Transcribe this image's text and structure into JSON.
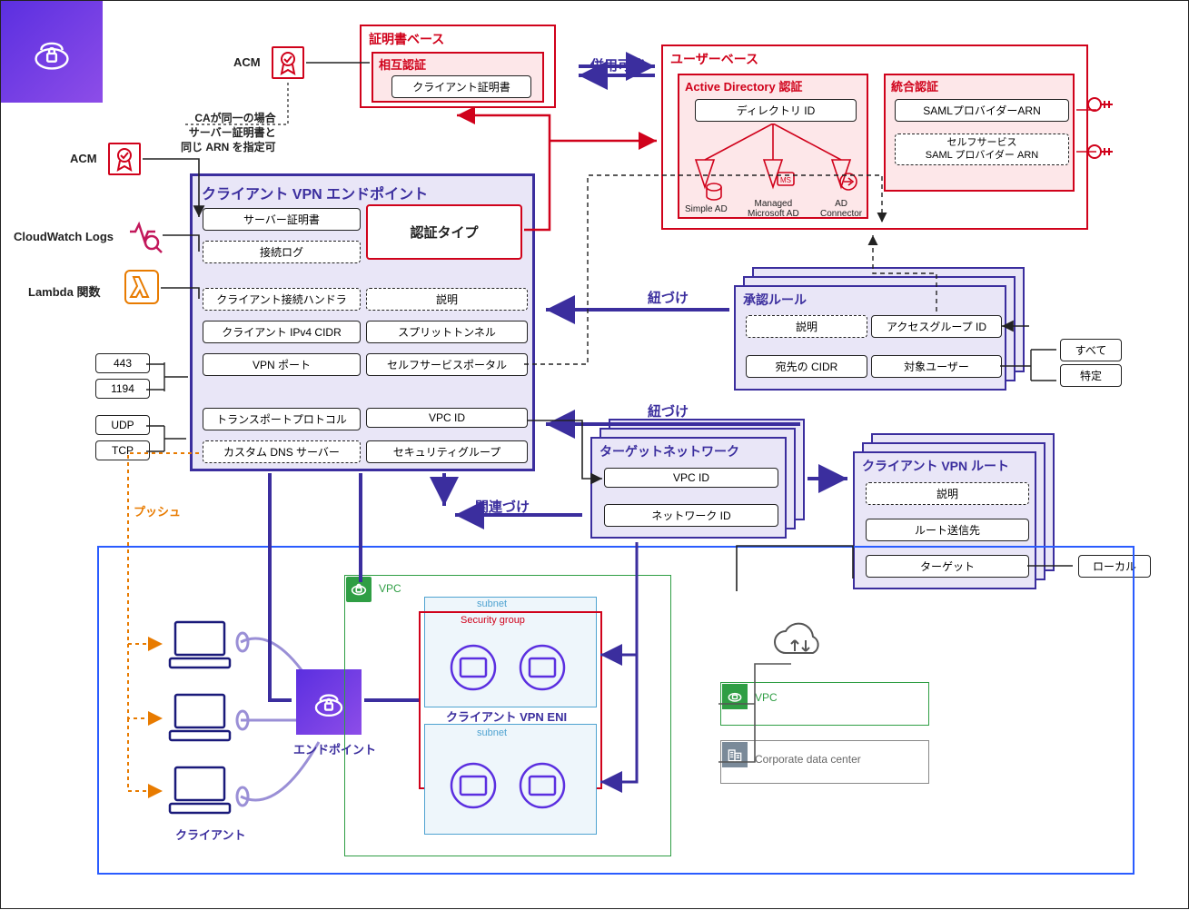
{
  "icon_labels": {
    "acm1": "ACM",
    "acm2": "ACM",
    "cwl": "CloudWatch Logs",
    "lambda": "Lambda 関数"
  },
  "ca_note": "CAが同一の場合\nサーバー証明書と\n同じ ARN を指定可",
  "cert_base": {
    "title": "証明書ベース",
    "mutual": {
      "title": "相互認証",
      "item": "クライアント証明書"
    }
  },
  "combine_label": "併用可能",
  "user_base": {
    "title": "ユーザーベース",
    "ad": {
      "title": "Active Directory 認証",
      "item": "ディレクトリ ID",
      "s1": "Simple AD",
      "s2": "Managed\nMicrosoft AD",
      "s3": "AD\nConnector"
    },
    "fed": {
      "title": "統合認証",
      "i1": "SAMLプロバイダーARN",
      "i2": "セルフサービス\nSAML プロバイダー ARN"
    }
  },
  "endpoint": {
    "title": "クライアント VPN エンドポイント",
    "left": [
      "サーバー証明書",
      "接続ログ",
      "クライアント接続ハンドラ",
      "クライアント IPv4 CIDR",
      "VPN ポート",
      "トランスポートプロトコル",
      "カスタム DNS サーバー"
    ],
    "auth_type": "認証タイプ",
    "right": [
      "説明",
      "スプリットトンネル",
      "セルフサービスポータル",
      "VPC ID",
      "セキュリティグループ"
    ],
    "left_dashed": [
      false,
      true,
      true,
      false,
      false,
      false,
      true
    ],
    "right_dashed": [
      true,
      false,
      false,
      false,
      false
    ]
  },
  "ports": [
    "443",
    "1194"
  ],
  "protocols": [
    "UDP",
    "TCP"
  ],
  "push_label": "プッシュ",
  "assoc_label": "関連づけ",
  "link1": "紐づけ",
  "link2": "紐づけ",
  "auth_rule": {
    "title": "承認ルール",
    "i1": "説明",
    "i2": "アクセスグループ ID",
    "i3": "宛先の CIDR",
    "i4": "対象ユーザー",
    "opt1": "すべて",
    "opt2": "特定"
  },
  "target_net": {
    "title": "ターゲットネットワーク",
    "i1": "VPC ID",
    "i2": "ネットワーク ID"
  },
  "routes": {
    "title": "クライアント VPN ルート",
    "i1": "説明",
    "i2": "ルート送信先",
    "i3": "ターゲット",
    "local": "ローカル"
  },
  "vpc_area": {
    "vpc": "VPC",
    "subnet1": "subnet",
    "sg": "Security group",
    "eni": "クライアント VPN ENI",
    "subnet2": "subnet",
    "endpoint": "エンドポイント",
    "client": "クライアント",
    "other_vpc": "VPC",
    "cdc": "Corporate data center"
  }
}
